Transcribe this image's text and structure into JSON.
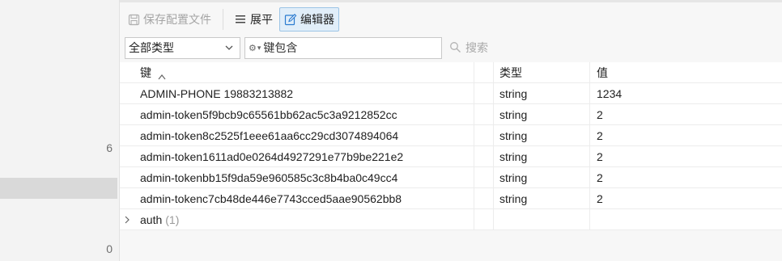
{
  "gutter": {
    "numbers": [
      "6",
      "0"
    ]
  },
  "toolbar": {
    "save_label": "保存配置文件",
    "flat_label": "展平",
    "editor_label": "编辑器"
  },
  "filter": {
    "type_select_value": "全部类型",
    "key_filter_text": "键包含",
    "search_placeholder": "搜索"
  },
  "table": {
    "headers": {
      "key": "键",
      "type": "类型",
      "value": "值"
    },
    "rows": [
      {
        "key": "ADMIN-PHONE 19883213882",
        "type": "string",
        "value": "1234"
      },
      {
        "key": "admin-token5f9bcb9c65561bb62ac5c3a9212852cc",
        "type": "string",
        "value": "2"
      },
      {
        "key": "admin-token8c2525f1eee61aa6cc29cd3074894064",
        "type": "string",
        "value": "2"
      },
      {
        "key": "admin-token1611ad0e0264d4927291e77b9be221e2",
        "type": "string",
        "value": "2"
      },
      {
        "key": "admin-tokenbb15f9da59e960585c3c8b4ba0c49cc4",
        "type": "string",
        "value": "2"
      },
      {
        "key": "admin-tokenc7cb48de446e7743cced5aae90562bb8",
        "type": "string",
        "value": "2"
      }
    ],
    "group": {
      "key": "auth",
      "count": "(1)"
    }
  }
}
